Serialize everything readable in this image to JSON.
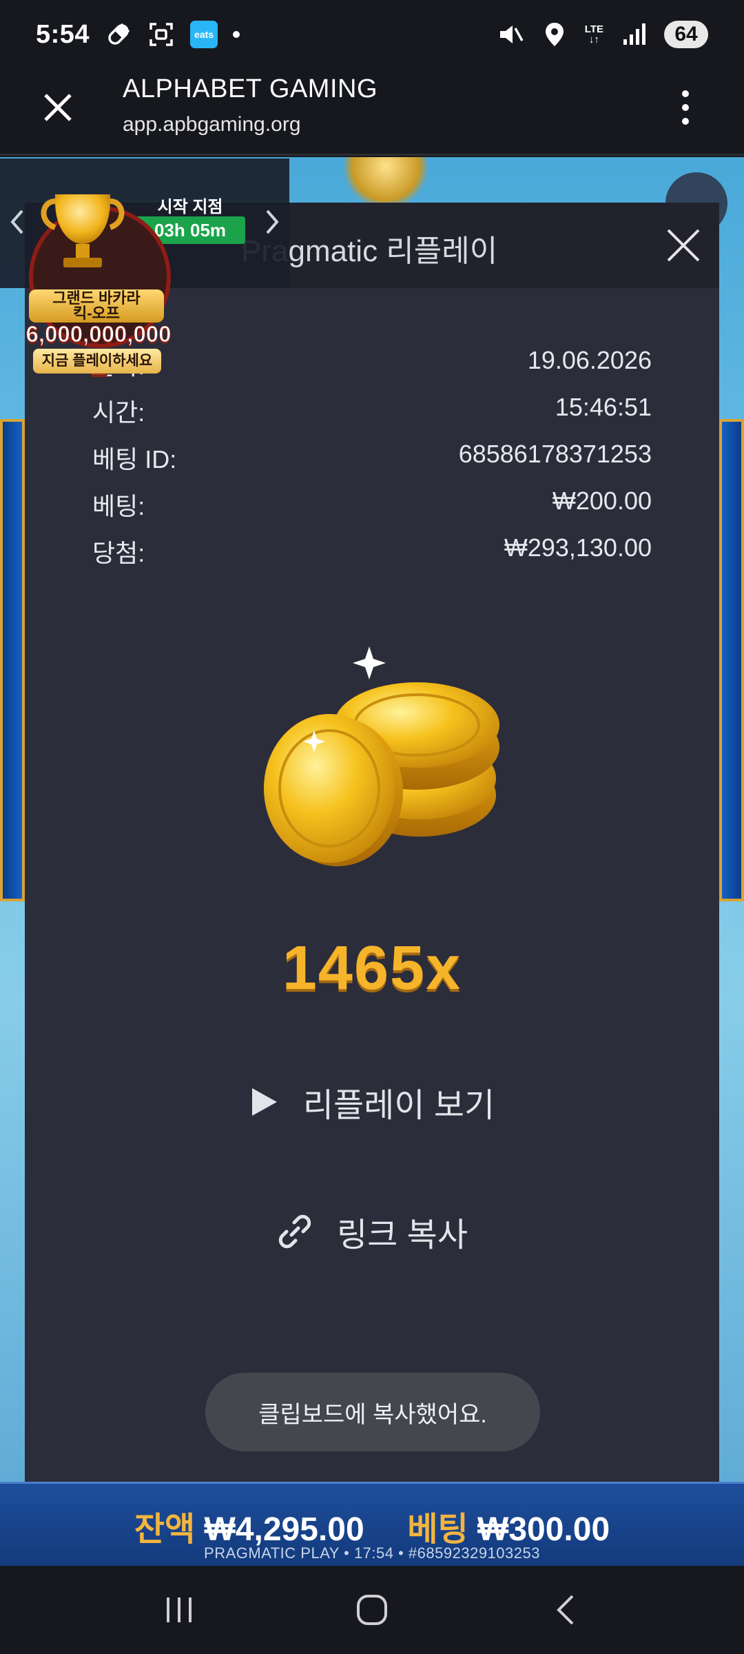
{
  "status_bar": {
    "time": "5:54",
    "eats_label": "eats",
    "network": "LTE",
    "battery": "64",
    "icons": [
      "pill-icon",
      "screenshot-icon",
      "eats-app-icon",
      "notification-dot",
      "mute-icon",
      "location-icon",
      "data-arrows-icon",
      "signal-icon",
      "battery-icon"
    ]
  },
  "browser": {
    "title": "ALPHABET GAMING",
    "url": "app.apbgaming.org"
  },
  "tournament": {
    "start_label": "시작 지점",
    "timer": "03h 05m",
    "title_line1": "그랜드 바카라",
    "title_line2": "킥-오프",
    "prize": "6,000,000,000원",
    "cta": "지금 플레이하세요"
  },
  "modal": {
    "title": "Pragmatic 리플레이",
    "rows": [
      {
        "label": "날짜:",
        "value": "19.06.2026"
      },
      {
        "label": "시간:",
        "value": "15:46:51"
      },
      {
        "label": "베팅 ID:",
        "value": "68586178371253"
      },
      {
        "label": "베팅:",
        "value": "₩200.00"
      },
      {
        "label": "당첨:",
        "value": "₩293,130.00"
      }
    ],
    "multiplier": "1465x",
    "watch_replay": "리플레이 보기",
    "copy_link": "링크 복사",
    "toast": "클립보드에 복사했어요."
  },
  "bottom_bar": {
    "balance_label": "잔액",
    "balance_value": "₩4,295.00",
    "bet_label": "베팅",
    "bet_value": "₩300.00",
    "footer": "PRAGMATIC PLAY • 17:54 • #68592329103253"
  },
  "colors": {
    "modal_bg": "#2c2d3b",
    "modal_header_bg": "#21222c",
    "gold": "#f6b42a",
    "green_timer": "#1aa34a",
    "toast_bg": "#45474f"
  }
}
